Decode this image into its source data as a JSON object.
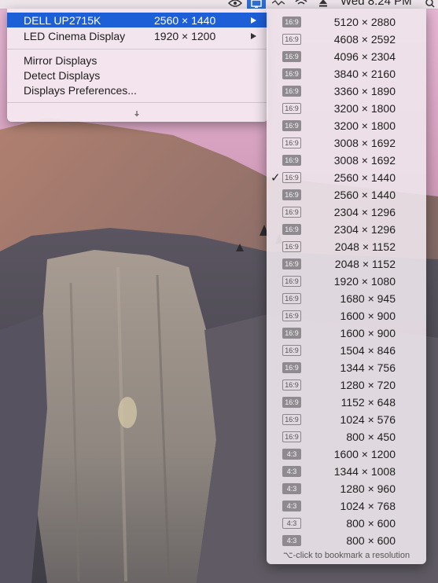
{
  "menubar": {
    "clock": "Wed 8:24 PM",
    "icons": [
      "nvidia-icon",
      "display-menu-icon",
      "activity-icon",
      "wifi-icon",
      "eject-icon",
      "spotlight-search-icon"
    ]
  },
  "menu": {
    "displays": [
      {
        "name": "DELL UP2715K",
        "resolution": "2560 × 1440",
        "active": true
      },
      {
        "name": "LED Cinema Display",
        "resolution": "1920 × 1200",
        "active": false
      }
    ],
    "actions": [
      {
        "label": "Mirror Displays"
      },
      {
        "label": "Detect Displays"
      },
      {
        "label": "Displays Preferences..."
      }
    ],
    "more_icon": "chevron-down-icon"
  },
  "submenu": {
    "items": [
      {
        "ratio": "16:9",
        "resolution": "5120 × 2880",
        "hidpi": true,
        "checked": false
      },
      {
        "ratio": "16:9",
        "resolution": "4608 × 2592",
        "hidpi": false,
        "checked": false
      },
      {
        "ratio": "16:9",
        "resolution": "4096 × 2304",
        "hidpi": true,
        "checked": false
      },
      {
        "ratio": "16:9",
        "resolution": "3840 × 2160",
        "hidpi": true,
        "checked": false
      },
      {
        "ratio": "16:9",
        "resolution": "3360 × 1890",
        "hidpi": true,
        "checked": false
      },
      {
        "ratio": "16:9",
        "resolution": "3200 × 1800",
        "hidpi": false,
        "checked": false
      },
      {
        "ratio": "16:9",
        "resolution": "3200 × 1800",
        "hidpi": true,
        "checked": false
      },
      {
        "ratio": "16:9",
        "resolution": "3008 × 1692",
        "hidpi": false,
        "checked": false
      },
      {
        "ratio": "16:9",
        "resolution": "3008 × 1692",
        "hidpi": true,
        "checked": false
      },
      {
        "ratio": "16:9",
        "resolution": "2560 × 1440",
        "hidpi": false,
        "checked": true
      },
      {
        "ratio": "16:9",
        "resolution": "2560 × 1440",
        "hidpi": true,
        "checked": false
      },
      {
        "ratio": "16:9",
        "resolution": "2304 × 1296",
        "hidpi": false,
        "checked": false
      },
      {
        "ratio": "16:9",
        "resolution": "2304 × 1296",
        "hidpi": true,
        "checked": false
      },
      {
        "ratio": "16:9",
        "resolution": "2048 × 1152",
        "hidpi": false,
        "checked": false
      },
      {
        "ratio": "16:9",
        "resolution": "2048 × 1152",
        "hidpi": true,
        "checked": false
      },
      {
        "ratio": "16:9",
        "resolution": "1920 × 1080",
        "hidpi": false,
        "checked": false
      },
      {
        "ratio": "16:9",
        "resolution": "1680 × 945",
        "hidpi": false,
        "checked": false
      },
      {
        "ratio": "16:9",
        "resolution": "1600 × 900",
        "hidpi": false,
        "checked": false
      },
      {
        "ratio": "16:9",
        "resolution": "1600 × 900",
        "hidpi": true,
        "checked": false
      },
      {
        "ratio": "16:9",
        "resolution": "1504 × 846",
        "hidpi": false,
        "checked": false
      },
      {
        "ratio": "16:9",
        "resolution": "1344 × 756",
        "hidpi": true,
        "checked": false
      },
      {
        "ratio": "16:9",
        "resolution": "1280 × 720",
        "hidpi": false,
        "checked": false
      },
      {
        "ratio": "16:9",
        "resolution": "1152 × 648",
        "hidpi": true,
        "checked": false
      },
      {
        "ratio": "16:9",
        "resolution": "1024 × 576",
        "hidpi": false,
        "checked": false
      },
      {
        "ratio": "16:9",
        "resolution": "800 × 450",
        "hidpi": false,
        "checked": false
      },
      {
        "ratio": "4:3",
        "resolution": "1600 × 1200",
        "hidpi": true,
        "checked": false
      },
      {
        "ratio": "4:3",
        "resolution": "1344 × 1008",
        "hidpi": true,
        "checked": false
      },
      {
        "ratio": "4:3",
        "resolution": "1280 × 960",
        "hidpi": true,
        "checked": false
      },
      {
        "ratio": "4:3",
        "resolution": "1024 × 768",
        "hidpi": true,
        "checked": false
      },
      {
        "ratio": "4:3",
        "resolution": "800 × 600",
        "hidpi": false,
        "checked": false
      },
      {
        "ratio": "4:3",
        "resolution": "800 × 600",
        "hidpi": true,
        "checked": false
      }
    ],
    "check_mark": "✓",
    "footer": "⌥-click to bookmark a resolution"
  },
  "colors": {
    "selection": "#1c5fd6",
    "sky_top": "#d8a3c4",
    "sky_bottom": "#a8607e",
    "rock": "#8c7f7a"
  }
}
